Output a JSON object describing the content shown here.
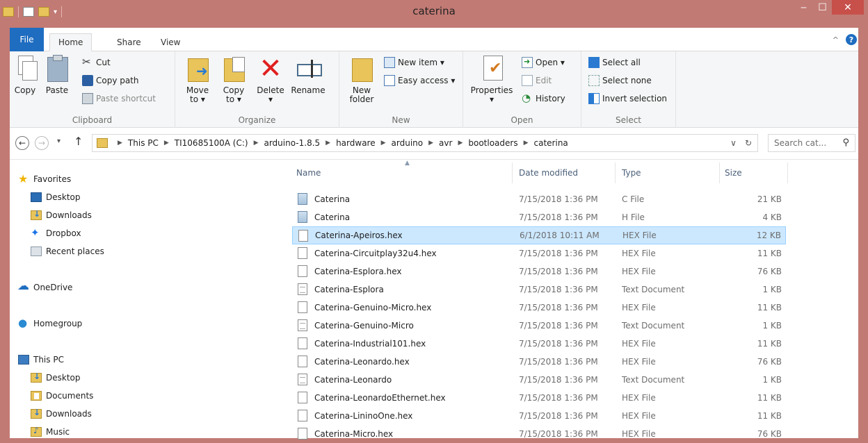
{
  "window": {
    "title": "caterina",
    "minimize": "‒",
    "maximize": "☐",
    "close": "✕"
  },
  "ribbon_tabs": [
    "File",
    "Home",
    "Share",
    "View"
  ],
  "ribbon": {
    "clipboard": {
      "label": "Clipboard",
      "copy": "Copy",
      "paste": "Paste",
      "cut": "Cut",
      "copy_path": "Copy path",
      "paste_shortcut": "Paste shortcut"
    },
    "organize": {
      "label": "Organize",
      "move_to": "Move\nto ▾",
      "copy_to": "Copy\nto ▾",
      "delete": "Delete\n▾",
      "rename": "Rename"
    },
    "new": {
      "label": "New",
      "new_folder": "New\nfolder",
      "new_item": "New item ▾",
      "easy_access": "Easy access ▾"
    },
    "open": {
      "label": "Open",
      "properties": "Properties\n▾",
      "open": "Open ▾",
      "edit": "Edit",
      "history": "History"
    },
    "select": {
      "label": "Select",
      "select_all": "Select all",
      "select_none": "Select none",
      "invert_selection": "Invert selection"
    }
  },
  "address": {
    "back": "←",
    "forward": "→",
    "recent_dropdown": "▾",
    "up": "↑",
    "crumbs": [
      "This PC",
      "TI10685100A (C:)",
      "arduino-1.8.5",
      "hardware",
      "arduino",
      "avr",
      "bootloaders",
      "caterina"
    ],
    "dropdown": "∨",
    "refresh": "↻",
    "search_placeholder": "Search cat...",
    "search_icon": "⚲"
  },
  "nav_pane": {
    "favorites": "Favorites",
    "fav_items": [
      "Desktop",
      "Downloads",
      "Dropbox",
      "Recent places"
    ],
    "onedrive": "OneDrive",
    "homegroup": "Homegroup",
    "this_pc": "This PC",
    "pc_items": [
      "Desktop",
      "Documents",
      "Downloads",
      "Music"
    ]
  },
  "columns": {
    "name": "Name",
    "date": "Date modified",
    "type": "Type",
    "size": "Size"
  },
  "files": [
    {
      "name": "Caterina",
      "date": "7/15/2018 1:36 PM",
      "type": "C File",
      "size": "21 KB",
      "icon": "code-file-icon"
    },
    {
      "name": "Caterina",
      "date": "7/15/2018 1:36 PM",
      "type": "H File",
      "size": "4 KB",
      "icon": "code-file-icon"
    },
    {
      "name": "Caterina-Apeiros.hex",
      "date": "6/1/2018 10:11 AM",
      "type": "HEX File",
      "size": "12 KB",
      "icon": "blank-file-icon"
    },
    {
      "name": "Caterina-Circuitplay32u4.hex",
      "date": "7/15/2018 1:36 PM",
      "type": "HEX File",
      "size": "11 KB",
      "icon": "blank-file-icon"
    },
    {
      "name": "Caterina-Esplora.hex",
      "date": "7/15/2018 1:36 PM",
      "type": "HEX File",
      "size": "76 KB",
      "icon": "blank-file-icon"
    },
    {
      "name": "Caterina-Esplora",
      "date": "7/15/2018 1:36 PM",
      "type": "Text Document",
      "size": "1 KB",
      "icon": "text-file-icon"
    },
    {
      "name": "Caterina-Genuino-Micro.hex",
      "date": "7/15/2018 1:36 PM",
      "type": "HEX File",
      "size": "11 KB",
      "icon": "blank-file-icon"
    },
    {
      "name": "Caterina-Genuino-Micro",
      "date": "7/15/2018 1:36 PM",
      "type": "Text Document",
      "size": "1 KB",
      "icon": "text-file-icon"
    },
    {
      "name": "Caterina-Industrial101.hex",
      "date": "7/15/2018 1:36 PM",
      "type": "HEX File",
      "size": "11 KB",
      "icon": "blank-file-icon"
    },
    {
      "name": "Caterina-Leonardo.hex",
      "date": "7/15/2018 1:36 PM",
      "type": "HEX File",
      "size": "76 KB",
      "icon": "blank-file-icon"
    },
    {
      "name": "Caterina-Leonardo",
      "date": "7/15/2018 1:36 PM",
      "type": "Text Document",
      "size": "1 KB",
      "icon": "text-file-icon"
    },
    {
      "name": "Caterina-LeonardoEthernet.hex",
      "date": "7/15/2018 1:36 PM",
      "type": "HEX File",
      "size": "11 KB",
      "icon": "blank-file-icon"
    },
    {
      "name": "Caterina-LininoOne.hex",
      "date": "7/15/2018 1:36 PM",
      "type": "HEX File",
      "size": "11 KB",
      "icon": "blank-file-icon"
    },
    {
      "name": "Caterina-Micro.hex",
      "date": "7/15/2018 1:36 PM",
      "type": "HEX File",
      "size": "76 KB",
      "icon": "blank-file-icon"
    }
  ],
  "selected_file": "Caterina-Apeiros.hex",
  "colors": {
    "titlebar": "#c27a74",
    "file_tab": "#1f6dc0",
    "selection": "#cce8ff",
    "close_button": "#c7504b"
  }
}
